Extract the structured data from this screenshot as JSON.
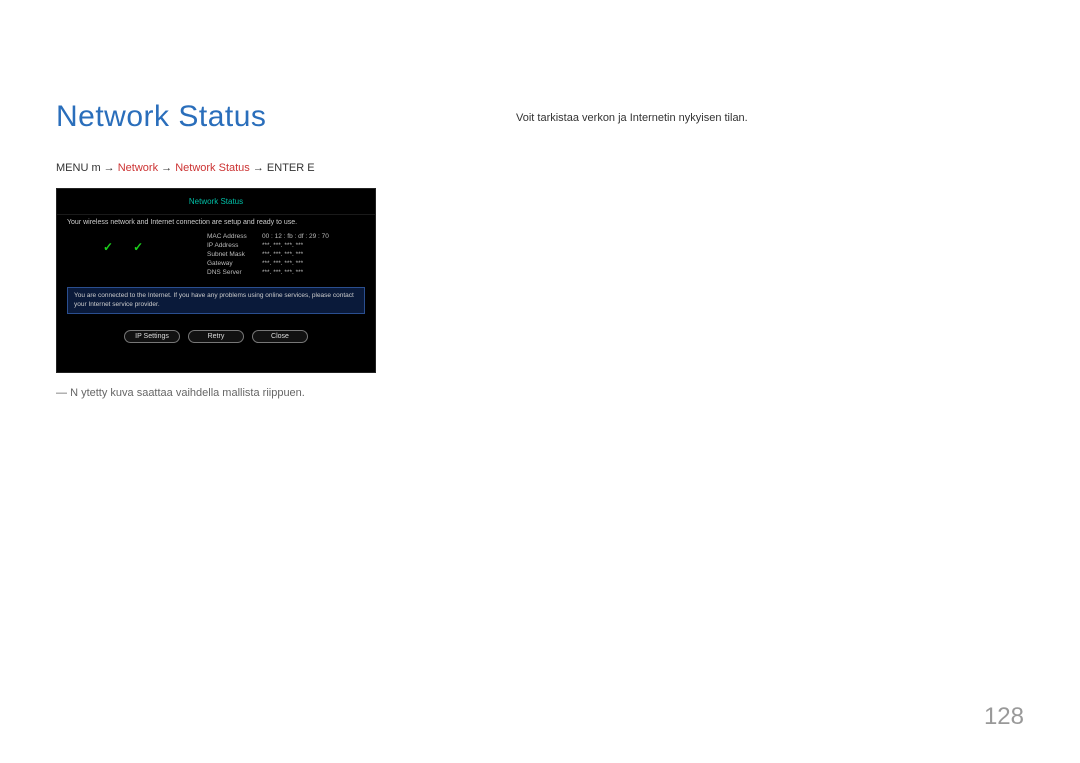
{
  "title": "Network Status",
  "menu_path": {
    "prefix": "MENU m → ",
    "red1": "Network",
    "arrow1": " → ",
    "red2": "Network Status",
    "suffix": " → ENTER E"
  },
  "panel": {
    "title": "Network Status",
    "msg1": "Your wireless network and Internet connection are setup and ready to use.",
    "rows": [
      {
        "label": "MAC Address",
        "value": "00 : 12 : fb : df : 29 : 70"
      },
      {
        "label": "IP Address",
        "value": "***.   ***.   ***.   ***"
      },
      {
        "label": "Subnet Mask",
        "value": "***.   ***.   ***.   ***"
      },
      {
        "label": "Gateway",
        "value": "***.   ***.   ***.   ***"
      },
      {
        "label": "DNS Server",
        "value": "***.   ***.   ***.   ***"
      }
    ],
    "msg_box": "You are connected to the Internet. If you have any problems using online services, please contact your Internet service provider.",
    "buttons": {
      "ip_settings": "IP Settings",
      "retry": "Retry",
      "close": "Close"
    }
  },
  "disclaimer_prefix": "―",
  "disclaimer": "N ytetty kuva saattaa vaihdella mallista riippuen.",
  "description": "Voit tarkistaa verkon ja Internetin nykyisen tilan.",
  "page_number": "128"
}
